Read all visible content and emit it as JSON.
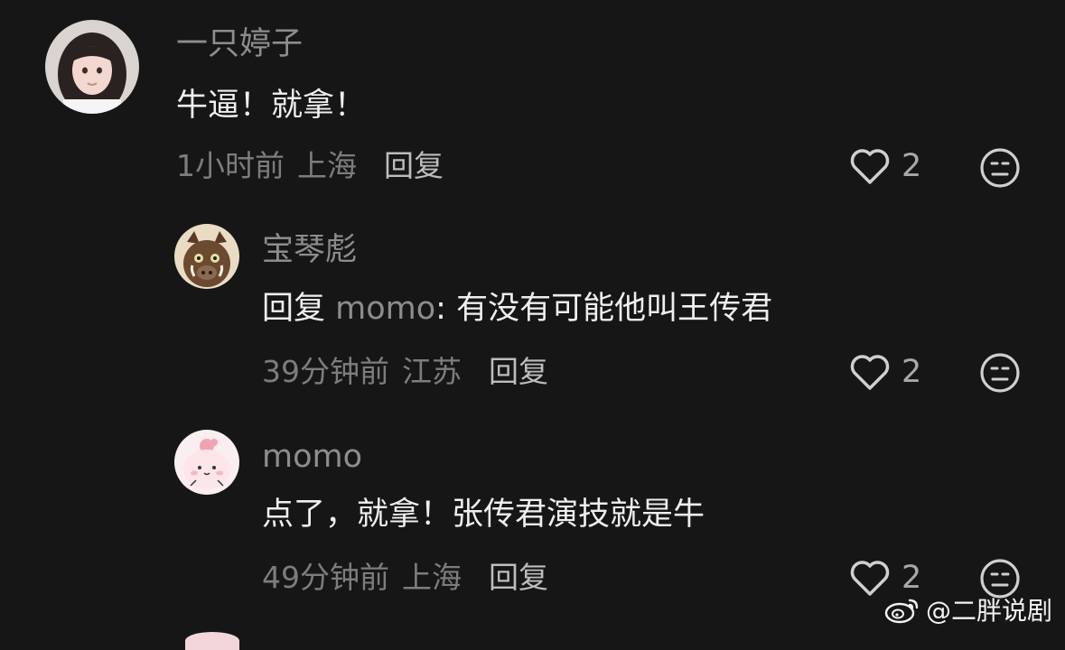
{
  "comments": [
    {
      "username": "一只婷子",
      "content": "牛逼！就拿！",
      "time": "1小时前",
      "location": "上海",
      "reply_label": "回复",
      "likes": "2",
      "avatar": "girl-photo-avatar"
    },
    {
      "username": "宝琴彪",
      "reply_prefix": "回复",
      "mention": "momo",
      "content": ": 有没有可能他叫王传君",
      "time": "39分钟前",
      "location": "江苏",
      "reply_label": "回复",
      "likes": "2",
      "avatar": "boar-cartoon-avatar"
    },
    {
      "username": "momo",
      "content": "点了，就拿！张传君演技就是牛",
      "time": "49分钟前",
      "location": "上海",
      "reply_label": "回复",
      "likes": "2",
      "avatar": "pink-cartoon-avatar"
    }
  ],
  "icons": {
    "like": "heart-outline-icon",
    "dislike": "neutral-face-icon"
  },
  "watermark": {
    "text": "@二胖说剧",
    "logo": "weibo-logo"
  },
  "colors": {
    "background": "#161616",
    "username": "#8d8d8d",
    "content": "#efefef",
    "meta": "#7d7d7d"
  }
}
